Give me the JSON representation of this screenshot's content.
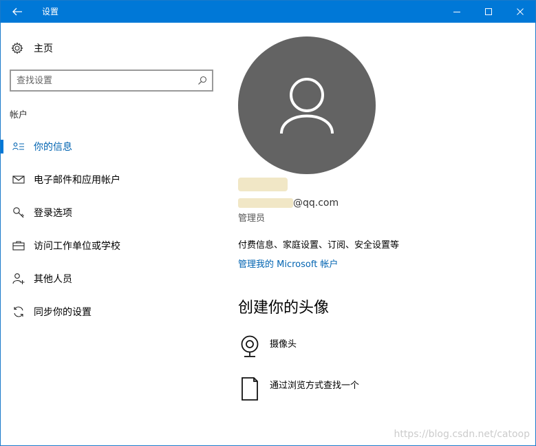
{
  "titlebar": {
    "title": "设置"
  },
  "sidebar": {
    "home_label": "主页",
    "search_placeholder": "查找设置",
    "section_label": "帐户",
    "items": [
      {
        "label": "你的信息",
        "icon": "user-info-icon",
        "active": true
      },
      {
        "label": "电子邮件和应用帐户",
        "icon": "mail-icon",
        "active": false
      },
      {
        "label": "登录选项",
        "icon": "key-icon",
        "active": false
      },
      {
        "label": "访问工作单位或学校",
        "icon": "briefcase-icon",
        "active": false
      },
      {
        "label": "其他人员",
        "icon": "add-person-icon",
        "active": false
      },
      {
        "label": "同步你的设置",
        "icon": "sync-icon",
        "active": false
      }
    ]
  },
  "main": {
    "email_suffix": "@qq.com",
    "role": "管理员",
    "billing_info": "付费信息、家庭设置、订阅、安全设置等",
    "manage_link": "管理我的 Microsoft 帐户",
    "create_heading": "创建你的头像",
    "options": [
      {
        "label": "摄像头",
        "icon": "webcam-icon"
      },
      {
        "label": "通过浏览方式查找一个",
        "icon": "document-icon"
      }
    ]
  },
  "watermark": "https://blog.csdn.net/catoop",
  "colors": {
    "accent": "#0078d7",
    "link": "#0063b1",
    "avatar_bg": "#636363"
  }
}
